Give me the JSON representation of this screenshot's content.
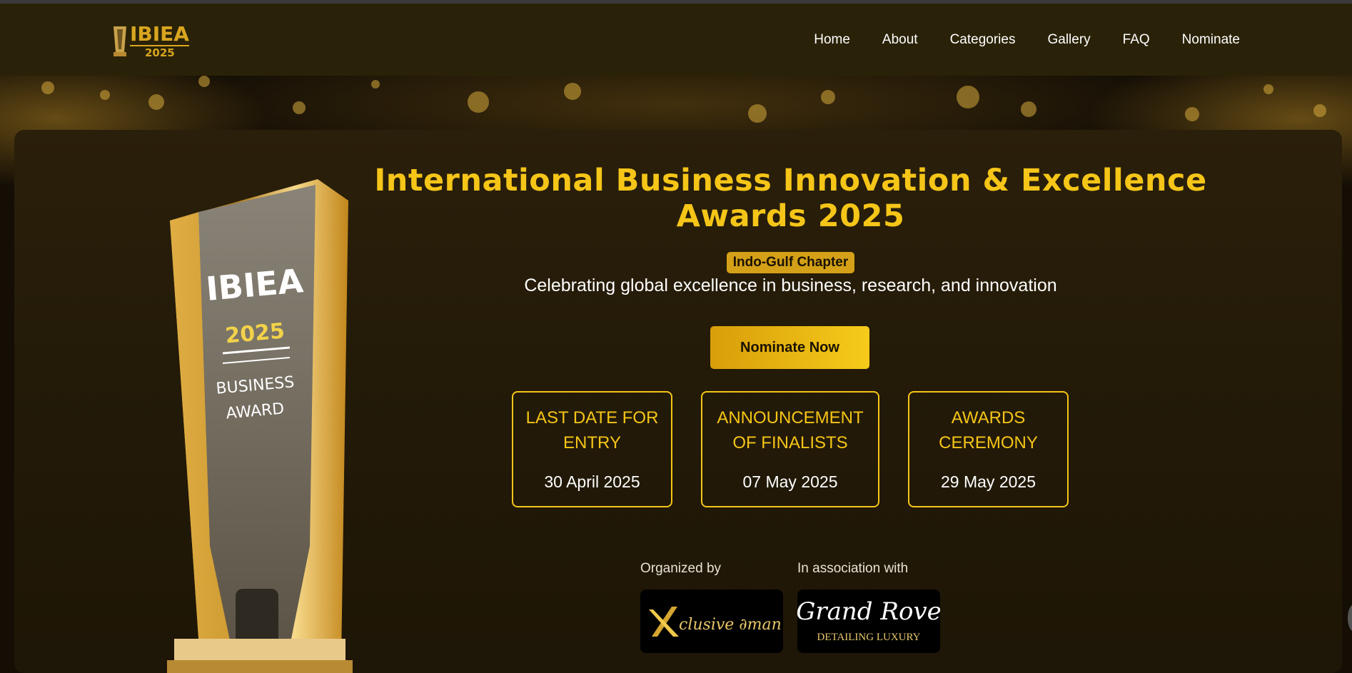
{
  "nav": {
    "logo_word": "IBIEA",
    "logo_year": "2025",
    "links": [
      "Home",
      "About",
      "Categories",
      "Gallery",
      "FAQ",
      "Nominate"
    ]
  },
  "hero": {
    "title_line1": "International Business Innovation & Excellence",
    "title_line2": "Awards 2025",
    "chapter": "Indo-Gulf Chapter",
    "subtitle": "Celebrating global excellence in business, research, and innovation",
    "cta": "Nominate Now"
  },
  "trophy": {
    "brand": "IBIEA",
    "year": "2025",
    "line1": "BUSINESS",
    "line2": "AWARD"
  },
  "dates": [
    {
      "label": "LAST DATE FOR ENTRY",
      "value": "30 April 2025"
    },
    {
      "label": "ANNOUNCEMENT OF FINALISTS",
      "value": "07 May 2025"
    },
    {
      "label": "AWARDS CEREMONY",
      "value": "29 May 2025"
    }
  ],
  "partners": {
    "organized_label": "Organized by",
    "association_label": "In association with",
    "organizer_logo_text": "clusive ∂man",
    "partner_logo_text": "Grand Rove",
    "partner_logo_tagline": "DETAILING LUXURY"
  },
  "colors": {
    "accent": "#f5c518",
    "nav_bg": "#2a2208",
    "panel_bg": "#231a08"
  }
}
